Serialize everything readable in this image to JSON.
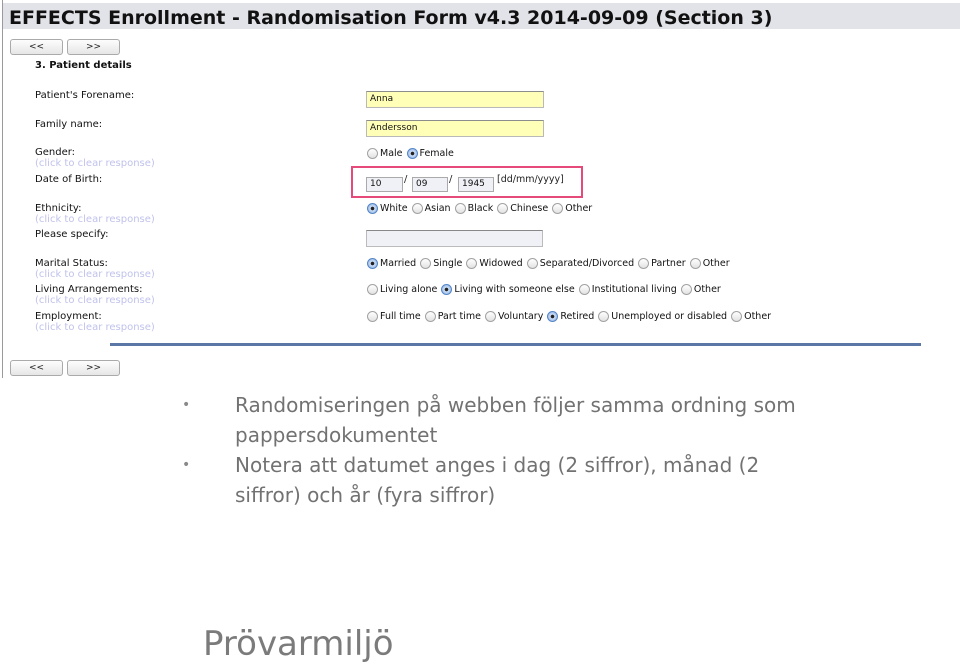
{
  "form": {
    "title": "EFFECTS Enrollment - Randomisation Form v4.3 2014-09-09 (Section 3)",
    "nav": {
      "prev_label": "<<",
      "next_label": ">>"
    },
    "section_title": "3. Patient details",
    "clear_label": "(click to clear response)",
    "fields": {
      "forename": {
        "label": "Patient's Forename:",
        "value": "Anna"
      },
      "family_name": {
        "label": "Family name:",
        "value": "Andersson"
      },
      "gender": {
        "label": "Gender:",
        "options": [
          "Male",
          "Female"
        ],
        "selected": "Female"
      },
      "dob": {
        "label": "Date of Birth:",
        "day": "10",
        "month": "09",
        "year": "1945",
        "separator": "/",
        "hint": "[dd/mm/yyyy]"
      },
      "ethnicity": {
        "label": "Ethnicity:",
        "options": [
          "White",
          "Asian",
          "Black",
          "Chinese",
          "Other"
        ],
        "selected": "White"
      },
      "please_specify": {
        "label": "Please specify:",
        "value": ""
      },
      "marital_status": {
        "label": "Marital Status:",
        "options": [
          "Married",
          "Single",
          "Widowed",
          "Separated/Divorced",
          "Partner",
          "Other"
        ],
        "selected": "Married"
      },
      "living": {
        "label": "Living Arrangements:",
        "options": [
          "Living alone",
          "Living with someone else",
          "Institutional living",
          "Other"
        ],
        "selected": "Living with someone else"
      },
      "employment": {
        "label": "Employment:",
        "options": [
          "Full time",
          "Part time",
          "Voluntary",
          "Retired",
          "Unemployed or disabled",
          "Other"
        ],
        "selected": "Retired"
      }
    },
    "colors": {
      "highlight_box": "#e64a7b",
      "input_fill": "#ffffb8",
      "clear_link": "#c0c2ec",
      "divider": "#5a77a6"
    }
  },
  "slide": {
    "bullets": [
      "Randomiseringen på webben följer samma ordning som pappersdokumentet",
      "Notera att datumet anges i dag (2 siffror), månad (2 siffror) och år (fyra siffror)"
    ],
    "footer_title": "Prövarmiljö"
  }
}
